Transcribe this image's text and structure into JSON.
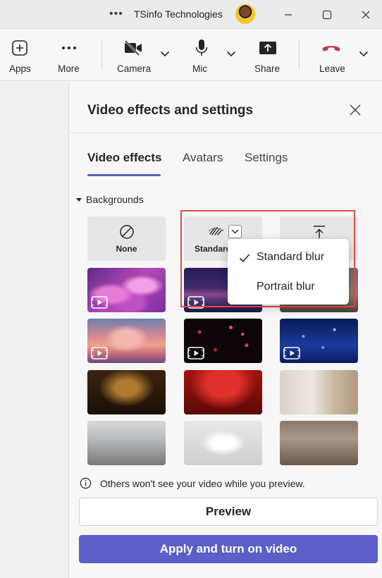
{
  "titlebar": {
    "title": "TSinfo Technologies",
    "more_icon": "ellipsis-icon",
    "controls": [
      "minimize-icon",
      "maximize-icon",
      "close-icon"
    ]
  },
  "toolbar": {
    "apps_label": "Apps",
    "more_label": "More",
    "camera_label": "Camera",
    "mic_label": "Mic",
    "share_label": "Share",
    "leave_label": "Leave"
  },
  "panel": {
    "title": "Video effects and settings",
    "tabs": [
      {
        "label": "Video effects",
        "active": true
      },
      {
        "label": "Avatars",
        "active": false
      },
      {
        "label": "Settings",
        "active": false
      }
    ],
    "section_title": "Backgrounds",
    "options": {
      "none_label": "None",
      "blur_label": "Standard"
    },
    "dropdown": {
      "items": [
        {
          "label": "Standard blur",
          "selected": true
        },
        {
          "label": "Portrait blur",
          "selected": false
        }
      ]
    },
    "info_text": "Others won't see your video while you preview.",
    "preview_label": "Preview",
    "apply_label": "Apply and turn on video"
  },
  "colors": {
    "accent": "#5b5fc7",
    "leave_red": "#c4314b",
    "highlight_box": "#e04a4a"
  }
}
